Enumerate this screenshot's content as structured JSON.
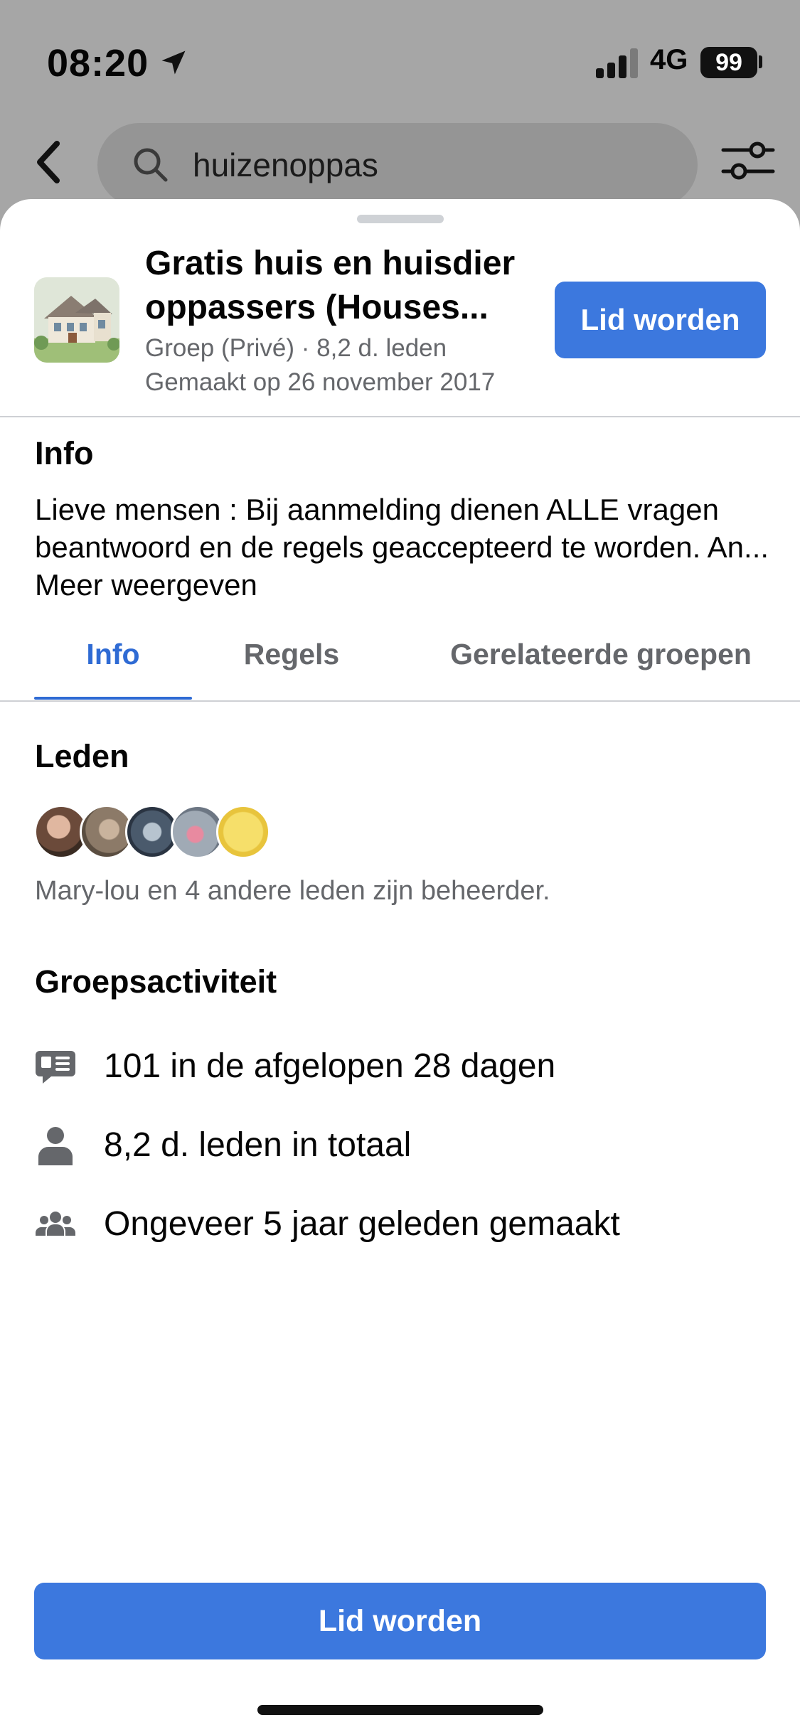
{
  "status_bar": {
    "time": "08:20",
    "network": "4G",
    "battery": "99"
  },
  "search": {
    "query": "huizenoppas"
  },
  "group": {
    "title": "Gratis huis en huisdier oppassers (Houses...",
    "meta_type_members": "Groep (Privé) · 8,2 d. leden",
    "meta_created": "Gemaakt op 26 november 2017",
    "join_label": "Lid worden"
  },
  "info": {
    "heading": "Info",
    "body": "Lieve mensen : Bij aanmelding dienen ALLE vragen beantwoord en de regels geaccepteerd te worden. An... Meer weergeven"
  },
  "tabs": [
    {
      "label": "Info",
      "active": true
    },
    {
      "label": "Regels",
      "active": false
    },
    {
      "label": "Gerelateerde groepen",
      "active": false
    }
  ],
  "members": {
    "heading": "Leden",
    "admins_text": "Mary-lou en 4 andere leden zijn beheerder."
  },
  "activity": {
    "heading": "Groepsactiviteit",
    "items": [
      {
        "icon": "chat-bubble-icon",
        "text": "101 in de afgelopen 28 dagen"
      },
      {
        "icon": "person-icon",
        "text": "8,2 d. leden in totaal"
      },
      {
        "icon": "group-people-icon",
        "text": "Ongeveer 5 jaar geleden gemaakt"
      }
    ]
  },
  "footer": {
    "join_label": "Lid worden"
  },
  "colors": {
    "accent": "#3c78de",
    "tab_active": "#2f6bd4",
    "secondary_text": "#65676b"
  }
}
